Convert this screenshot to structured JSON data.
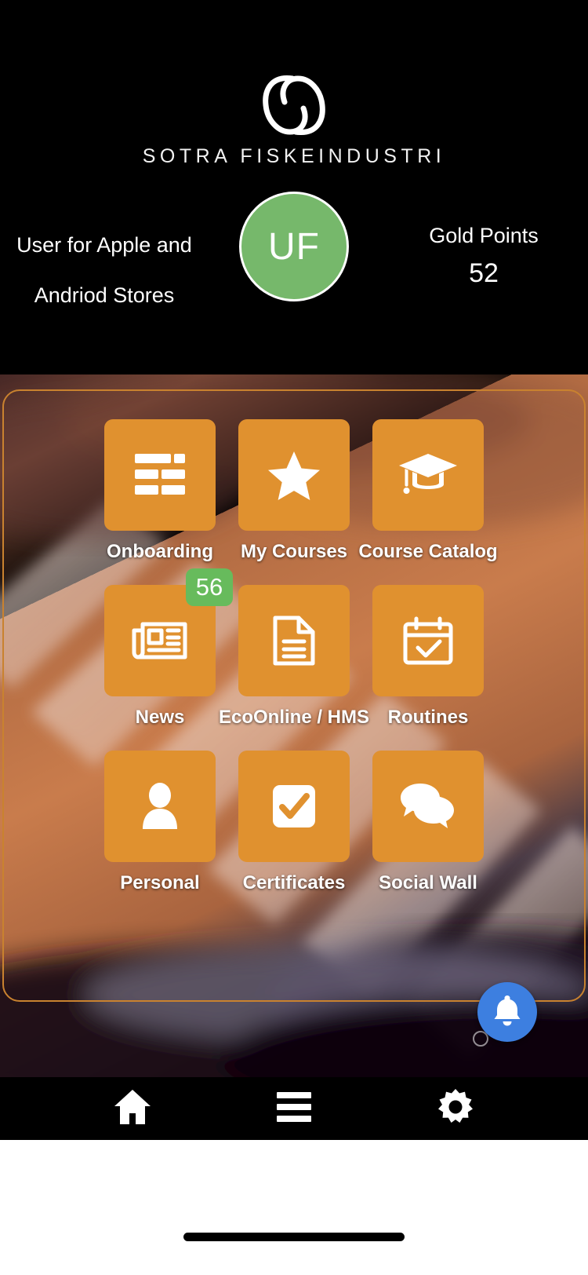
{
  "header": {
    "logo_icon": "sotra-s-logo",
    "brand_name": "SOTRA FISKEINDUSTRI",
    "user_name": "User for Apple and Andriod Stores",
    "avatar_initials": "UF",
    "points_label": "Gold Points",
    "points_value": "52"
  },
  "theme": {
    "tile_color": "#e0912f",
    "badge_color": "#67bb5c",
    "avatar_color": "#76b86b",
    "fab_color": "#3d7fe0",
    "header_bg": "#000000",
    "panel_border": "#c9822f"
  },
  "grid": {
    "rows": [
      [
        {
          "label": "Onboarding",
          "icon": "tasks-list-icon",
          "badge": null
        },
        {
          "label": "My Courses",
          "icon": "star-icon",
          "badge": null
        },
        {
          "label": "Course Catalog",
          "icon": "graduation-cap-icon",
          "badge": null
        }
      ],
      [
        {
          "label": "News",
          "icon": "newspaper-icon",
          "badge": "56"
        },
        {
          "label": "EcoOnline / HMS",
          "icon": "document-icon",
          "badge": null
        },
        {
          "label": "Routines",
          "icon": "calendar-check-icon",
          "badge": null
        }
      ],
      [
        {
          "label": "Personal",
          "icon": "person-icon",
          "badge": null
        },
        {
          "label": "Certificates",
          "icon": "checkbox-checked-icon",
          "badge": null
        },
        {
          "label": "Social Wall",
          "icon": "chat-bubbles-icon",
          "badge": null
        }
      ]
    ]
  },
  "fab": {
    "icon": "bell-icon",
    "label": "Notifications"
  },
  "bottom_nav": {
    "items": [
      {
        "icon": "home-icon",
        "label": "Home"
      },
      {
        "icon": "menu-icon",
        "label": "Menu"
      },
      {
        "icon": "gear-icon",
        "label": "Settings"
      }
    ]
  }
}
